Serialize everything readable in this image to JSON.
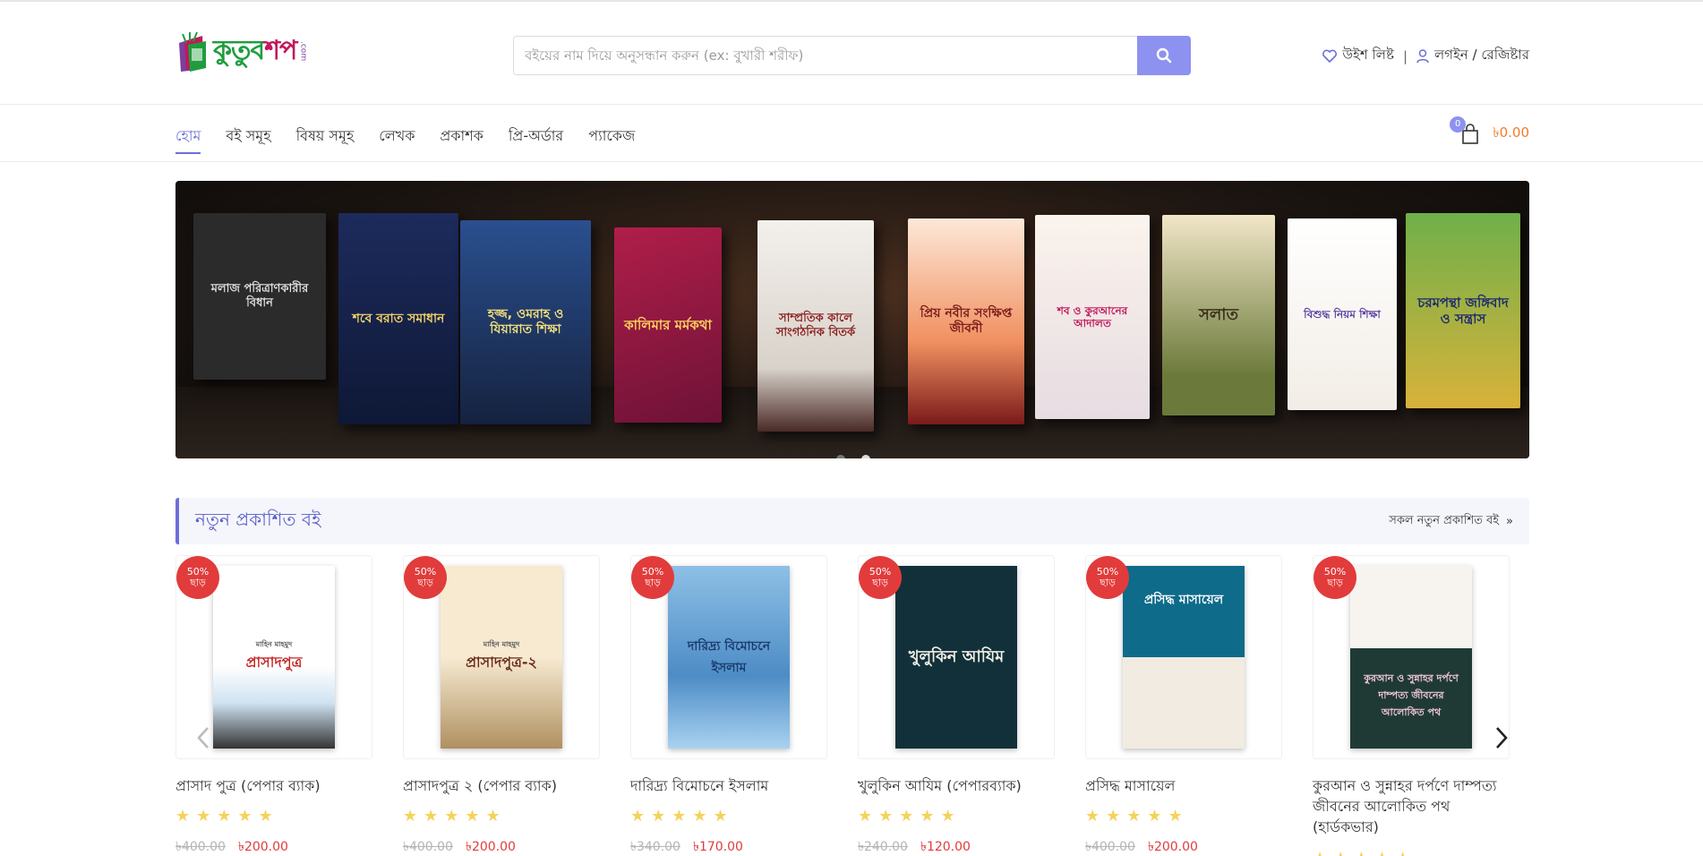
{
  "header": {
    "logo_text": "কুতুব",
    "logo_accent": "শপ",
    "logo_suffix": ".com",
    "search_placeholder": "বইয়ের নাম দিয়ে অনুসন্ধান করুন (ex: বুখারী শরীফ)",
    "wishlist_label": "উইশ লিষ্ট",
    "separator": "|",
    "login_label": "লগইন / রেজিষ্টার"
  },
  "nav": {
    "items": [
      {
        "label": "হোম"
      },
      {
        "label": "বই সমূহ"
      },
      {
        "label": "বিষয় সমূহ"
      },
      {
        "label": "লেখক"
      },
      {
        "label": "প্রকাশক"
      },
      {
        "label": "প্রি-অর্ডার"
      },
      {
        "label": "প্যাকেজ"
      }
    ],
    "cart_count": "0",
    "cart_total": "৳0.00"
  },
  "banner": {
    "books": [
      {
        "title": "মলাজ পরিত্রাণকারীর বিধান"
      },
      {
        "title": "শবে বরাত সমাধান"
      },
      {
        "title": "হজ্জ, ওমরাহ ও যিয়ারাত শিক্ষা"
      },
      {
        "title": "কালিমার মর্মকথা"
      },
      {
        "title": "সাম্প্রতিক কালে সাংগঠনিক বিতর্ক"
      },
      {
        "title": "প্রিয় নবীর সংক্ষিপ্ত জীবনী"
      },
      {
        "title": "শব ও কুরআনের আদালত"
      },
      {
        "title": "সলাত"
      },
      {
        "title": "বিশুদ্ধ নিয়ম শিক্ষা"
      },
      {
        "title": "চরমপন্থা জঙ্গিবাদ ও সন্ত্রাস"
      }
    ]
  },
  "section": {
    "title": "নতুন প্রকাশিত বই",
    "view_all": "সকল নতুন প্রকাশিত বই",
    "view_all_icon": "»"
  },
  "products": [
    {
      "name": "প্রাসাদ পুত্র (পেপার ব্যাক)",
      "old_price": "৳400.00",
      "new_price": "৳200.00",
      "badge_pct": "50%",
      "badge_off": "ছাড়",
      "cover_title": "প্রাসাদপুত্র",
      "cover_author": "মাহিন মাহমুদ",
      "rating": 5,
      "stars": "★★★★★"
    },
    {
      "name": "প্রাসাদপুত্র ২ (পেপার ব্যাক)",
      "old_price": "৳400.00",
      "new_price": "৳200.00",
      "badge_pct": "50%",
      "badge_off": "ছাড়",
      "cover_title": "প্রাসাদপুত্র-২",
      "cover_author": "মাহিন মাহমুদ",
      "rating": 5,
      "stars": "★★★★★"
    },
    {
      "name": "দারিদ্র্য বিমোচনে ইসলাম",
      "old_price": "৳340.00",
      "new_price": "৳170.00",
      "badge_pct": "50%",
      "badge_off": "ছাড়",
      "cover_title": "দারিদ্র্য বিমোচনে ইসলাম",
      "cover_author": "",
      "rating": 5,
      "stars": "★★★★★"
    },
    {
      "name": "খুলুকিন আযিম (পেপারব্যাক)",
      "old_price": "৳240.00",
      "new_price": "৳120.00",
      "badge_pct": "50%",
      "badge_off": "ছাড়",
      "cover_title": "খুলুকিন আযিম",
      "cover_author": "",
      "rating": 5,
      "stars": "★★★★★"
    },
    {
      "name": "প্রসিদ্ধ মাসায়েল",
      "old_price": "৳400.00",
      "new_price": "৳200.00",
      "badge_pct": "50%",
      "badge_off": "ছাড়",
      "cover_title": "প্রসিদ্ধ মাসায়েল",
      "cover_author": "",
      "rating": 5,
      "stars": "★★★★★"
    },
    {
      "name": "কুরআন ও সুন্নাহর দর্পণে দাম্পত্য জীবনের আলোকিত পথ (হার্ডকভার)",
      "old_price": "",
      "new_price": "",
      "badge_pct": "50%",
      "badge_off": "ছাড়",
      "cover_title": "কুরআন ও সুন্নাহর দর্পণে দাম্পত্য জীবনের আলোকিত পথ",
      "cover_author": "",
      "rating": 5,
      "stars": "★★★★★"
    }
  ],
  "colors": {
    "accent": "#6b6fd9",
    "search_button": "#8d92f0",
    "badge": "#e23b3b",
    "price": "#e23b3b",
    "cart_total": "#f07b2a",
    "star": "#f5d25a"
  },
  "icons": {
    "search": "search-icon",
    "wishlist": "heart-icon",
    "login": "user-icon",
    "cart": "shopping-bag-icon",
    "prev": "chevron-left-icon",
    "next": "chevron-right-icon"
  }
}
